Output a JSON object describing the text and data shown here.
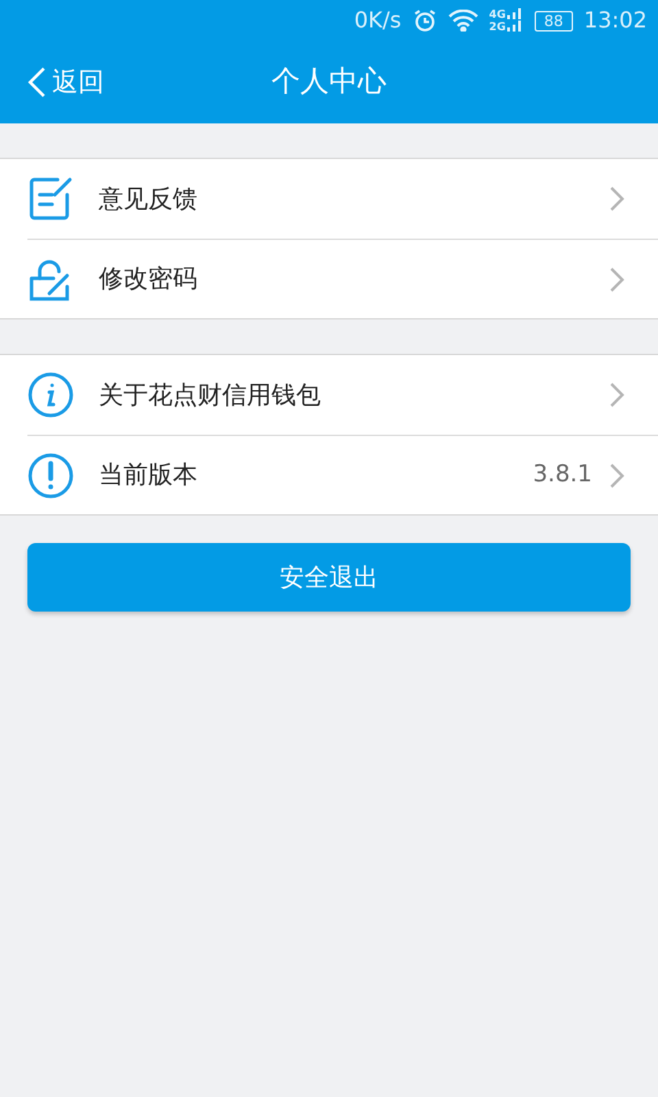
{
  "status_bar": {
    "speed": "0K/s",
    "network_top": "4G",
    "network_bottom": "2G",
    "battery": "88",
    "time": "13:02"
  },
  "header": {
    "back": "返回",
    "title": "个人中心"
  },
  "groups": [
    {
      "items": [
        {
          "kind": "edit",
          "label": "意见反馈"
        },
        {
          "kind": "lock",
          "label": "修改密码"
        }
      ]
    },
    {
      "items": [
        {
          "kind": "info",
          "label": "关于花点财信用钱包"
        },
        {
          "kind": "alert",
          "label": "当前版本",
          "value": "3.8.1"
        }
      ]
    }
  ],
  "logout": "安全退出"
}
